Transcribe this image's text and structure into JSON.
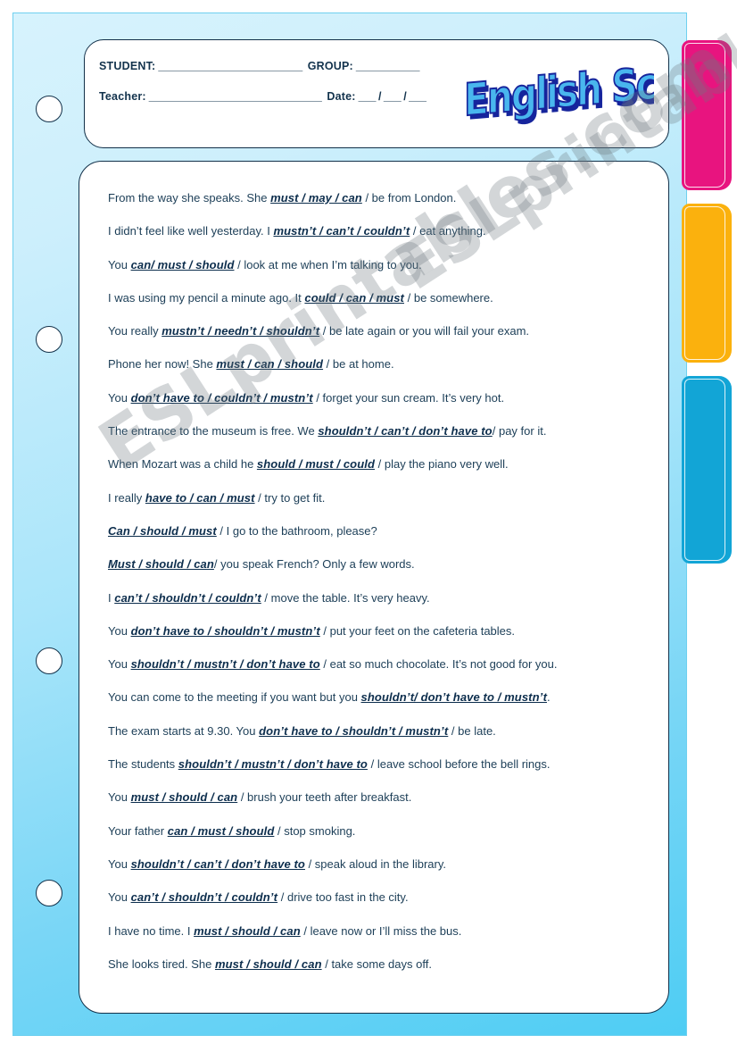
{
  "page": {
    "sheet_color_top": "#d7f3fd",
    "sheet_color_bottom": "#4ecdf4",
    "card_border_color": "#123049",
    "text_color": "#15354e"
  },
  "tabs": [
    {
      "name": "pink",
      "color": "#e8147f"
    },
    {
      "name": "orange",
      "color": "#fbb10d"
    },
    {
      "name": "cyan",
      "color": "#12a5d6"
    }
  ],
  "header": {
    "student_label": "STUDENT:",
    "student_blank": "_________________________",
    "group_label": "GROUP:",
    "group_blank": "___________",
    "teacher_label": "Teacher:",
    "teacher_blank": "______________________________",
    "date_label": "Date:",
    "date_blank": "___ / ___ / ___",
    "logo_text": "English School",
    "logo_fill": "#49b6ee",
    "logo_shadow": "#16249c"
  },
  "watermark": {
    "line1": "ESLprintables.com",
    "line2": "ESLprintables.com"
  },
  "exercises": [
    {
      "pre": "From the way she speaks. She ",
      "choice": "must / may /  can",
      "post": " / be from London."
    },
    {
      "pre": "I didn’t feel like well yesterday. I ",
      "choice": "mustn’t / can’t /  couldn’t",
      "post": " /  eat anything."
    },
    {
      "pre": "You ",
      "choice": "can/  must /  should",
      "post": " / look at me when I’m talking to you."
    },
    {
      "pre": "I was using my pencil a minute ago. It ",
      "choice": "could / can / must",
      "post": " / be somewhere."
    },
    {
      "pre": "You really ",
      "choice": "mustn’t /  needn’t /  shouldn’t",
      "post": " /  be late again or you will fail your exam."
    },
    {
      "pre": "Phone her now! She ",
      "choice": "must /  can  / should",
      "post": " / be at home."
    },
    {
      "pre": "You ",
      "choice": "don’t have to / couldn’t /  mustn’t",
      "post": " /  forget your sun cream. It’s very hot."
    },
    {
      "pre": "The entrance to the museum is free. We ",
      "choice": "shouldn’t /  can’t / don’t have to",
      "post": "/ pay for it."
    },
    {
      "pre": "When Mozart was a child he ",
      "choice": "should / must /  could",
      "post": " /  play the piano very well."
    },
    {
      "pre": "I really ",
      "choice": "have to /  can / must",
      "post": " /  try to get fit."
    },
    {
      "pre": "",
      "choice": "Can / should / must",
      "post": " / I go to the bathroom, please?"
    },
    {
      "pre": "",
      "choice": "Must /  should / can",
      "post": "/  you speak French? Only  a few words."
    },
    {
      "pre": "I ",
      "choice": "can’t / shouldn’t / couldn’t",
      "post": " / move the table. It’s very heavy."
    },
    {
      "pre": "You ",
      "choice": "don’t have to / shouldn’t /  mustn’t",
      "post": " / put your feet on the cafeteria tables."
    },
    {
      "pre": "You ",
      "choice": "shouldn’t / mustn’t / don’t have to",
      "post": " / eat so much chocolate. It’s not good for you."
    },
    {
      "pre": "You can come to the meeting if you want but you ",
      "choice": "shouldn’t/ don’t have to / mustn’t",
      "post": "."
    },
    {
      "pre": "The exam starts at 9.30.  You ",
      "choice": "don’t have to / shouldn’t / mustn’t",
      "post": " / be late."
    },
    {
      "pre": "The students ",
      "choice": "shouldn’t / mustn’t / don’t have to",
      "post": " / leave school before the bell rings."
    },
    {
      "pre": "You ",
      "choice": "must / should /  can",
      "post": " / brush your teeth after breakfast."
    },
    {
      "pre": "Your father ",
      "choice": "can /  must /  should",
      "post": " /  stop smoking."
    },
    {
      "pre": "You ",
      "choice": "shouldn’t /  can’t / don’t have to",
      "post": " /  speak  aloud in the library."
    },
    {
      "pre": "You ",
      "choice": "can’t /  shouldn’t / couldn’t",
      "post": " / drive too fast in the city."
    },
    {
      "pre": "I have no time. I ",
      "choice": "must /  should /  can",
      "post": " / leave now or  I’ll miss the bus."
    },
    {
      "pre": "She looks tired. She ",
      "choice": "must /  should / can",
      "post": " /  take some days off."
    }
  ],
  "holes": [
    122,
    380,
    740,
    1000
  ]
}
